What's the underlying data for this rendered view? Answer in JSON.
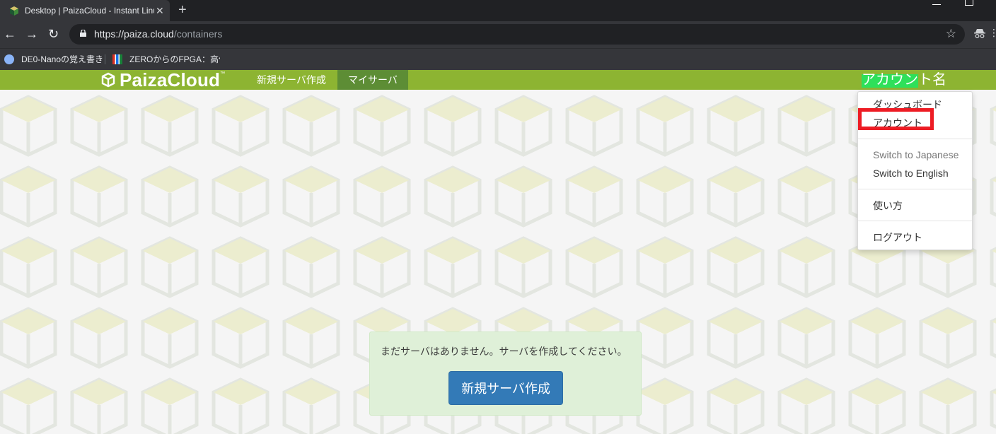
{
  "browser": {
    "tab": {
      "title": "Desktop | PaizaCloud - Instant Linux Cloud",
      "close_glyph": "✕"
    },
    "new_tab_glyph": "+",
    "nav": {
      "back": "←",
      "forward": "→",
      "reload": "↻"
    },
    "address": {
      "host": "https://paiza.cloud",
      "path": "/containers"
    },
    "star_glyph": "☆",
    "bookmarks": [
      {
        "label": "DE0-Nanoの覚え書き",
        "icon": "chat-bubble-icon"
      },
      {
        "label": "ZEROからのFPGA：高位",
        "icon": "bar-chart-icon"
      }
    ]
  },
  "header": {
    "logo": {
      "text": "PaizaCloud",
      "tm": "™"
    },
    "nav": [
      {
        "label": "新規サーバ作成",
        "active": false
      },
      {
        "label": "マイサーバ",
        "active": true
      }
    ],
    "account": {
      "highlighted": "アカウン",
      "rest": "ト名"
    },
    "brand_color": "#8db432",
    "active_color": "#5d8d35"
  },
  "dropdown": {
    "items": [
      {
        "label": "ダッシュボード"
      },
      {
        "label": "アカウント"
      },
      {
        "label": "Switch to Japanese",
        "muted": true
      },
      {
        "label": "Switch to English"
      },
      {
        "label": "使い方"
      },
      {
        "label": "ログアウト"
      }
    ],
    "highlight_color": "#ed1c24"
  },
  "notice": {
    "text": "まだサーバはありません。サーバを作成してください。",
    "button": "新規サーバ作成",
    "button_color": "#337ab7"
  }
}
